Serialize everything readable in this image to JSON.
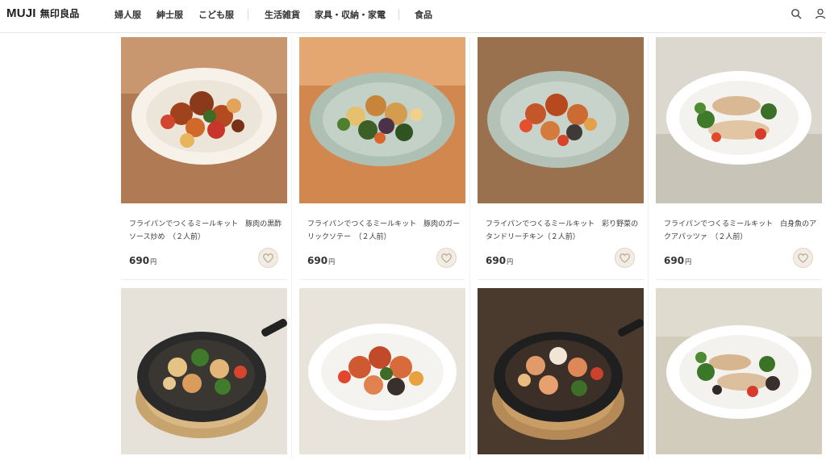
{
  "header": {
    "logo_text": "MUJI",
    "logo_kanji": "無印良品",
    "nav": [
      {
        "label": "婦人服"
      },
      {
        "label": "紳士服"
      },
      {
        "label": "こども服"
      },
      {
        "label": "生活雑貨"
      },
      {
        "label": "家具・収納・家電"
      },
      {
        "label": "食品"
      }
    ],
    "icons": [
      "search-icon",
      "user-icon"
    ]
  },
  "products": [
    {
      "title": "フライパンでつくるミールキット　豚肉の黒酢ソース炒め　（２人前）",
      "price": "690",
      "currency": "円",
      "image": "pork-black-vinegar-dish"
    },
    {
      "title": "フライパンでつくるミールキット　豚肉のガーリックソテー　（２人前）",
      "price": "690",
      "currency": "円",
      "image": "pork-garlic-saute-dish"
    },
    {
      "title": "フライパンでつくるミールキット　彩り野菜のタンドリーチキン（２人前）",
      "price": "690",
      "currency": "円",
      "image": "tandoori-chicken-dish"
    },
    {
      "title": "フライパンでつくるミールキット　白身魚のアクアパッツァ　（２人前）",
      "price": "690",
      "currency": "円",
      "image": "white-fish-acqua-pazza-dish"
    },
    {
      "title": "",
      "price": "",
      "currency": "",
      "image": "skillet-vegetable-dish"
    },
    {
      "title": "",
      "price": "",
      "currency": "",
      "image": "chicken-tomato-dish"
    },
    {
      "title": "",
      "price": "",
      "currency": "",
      "image": "skillet-seafood-dish"
    },
    {
      "title": "",
      "price": "",
      "currency": "",
      "image": "fish-broccoli-dish"
    }
  ],
  "colors": {
    "accent": "#7f0019",
    "fav_bg": "#f2ece3",
    "heart": "#b9a896"
  }
}
